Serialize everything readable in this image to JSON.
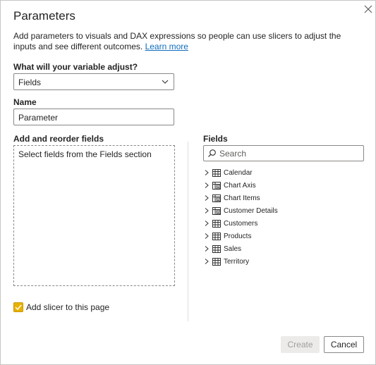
{
  "dialog": {
    "title": "Parameters",
    "description": "Add parameters to visuals and DAX expressions so people can use slicers to adjust the inputs and see different outcomes.",
    "learn_more": "Learn more"
  },
  "variable": {
    "label": "What will your variable adjust?",
    "selected": "Fields"
  },
  "name": {
    "label": "Name",
    "value": "Parameter"
  },
  "reorder": {
    "label": "Add and reorder fields",
    "placeholder": "Select fields from the Fields section"
  },
  "fields": {
    "label": "Fields",
    "search_placeholder": "Search",
    "items": [
      {
        "label": "Calendar",
        "icon": "table-icon"
      },
      {
        "label": "Chart Axis",
        "icon": "calc-table-icon"
      },
      {
        "label": "Chart Items",
        "icon": "calc-table-icon"
      },
      {
        "label": "Customer Details",
        "icon": "calc-table-icon"
      },
      {
        "label": "Customers",
        "icon": "table-icon"
      },
      {
        "label": "Products",
        "icon": "table-icon"
      },
      {
        "label": "Sales",
        "icon": "table-icon"
      },
      {
        "label": "Territory",
        "icon": "table-icon"
      }
    ]
  },
  "slicer": {
    "label": "Add slicer to this page",
    "checked": true
  },
  "buttons": {
    "create": "Create",
    "cancel": "Cancel"
  },
  "colors": {
    "checkbox": "#e8b200",
    "link": "#0f6cbd"
  }
}
